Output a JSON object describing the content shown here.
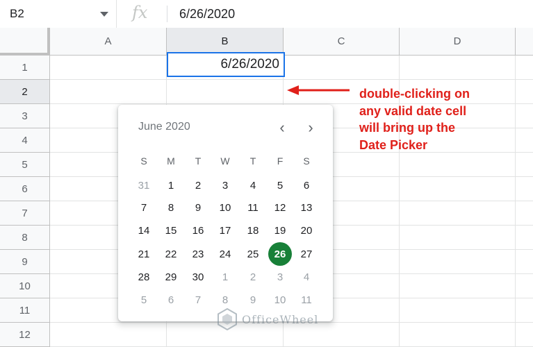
{
  "formula_bar": {
    "name_box": "B2",
    "fx_label": "fx",
    "value": "6/26/2020"
  },
  "columns": [
    "A",
    "B",
    "C",
    "D"
  ],
  "rows": [
    "1",
    "2",
    "3",
    "4",
    "5",
    "6",
    "7",
    "8",
    "9",
    "10",
    "11",
    "12"
  ],
  "selected_column": "B",
  "selected_row": "2",
  "active_cell": {
    "ref": "B2",
    "value": "6/26/2020"
  },
  "date_picker": {
    "month_label": "June 2020",
    "prev_icon": "chevron-left-icon",
    "next_icon": "chevron-right-icon",
    "weekdays": [
      "S",
      "M",
      "T",
      "W",
      "T",
      "F",
      "S"
    ],
    "weeks": [
      [
        "31",
        "1",
        "2",
        "3",
        "4",
        "5",
        "6"
      ],
      [
        "7",
        "8",
        "9",
        "10",
        "11",
        "12",
        "13"
      ],
      [
        "14",
        "15",
        "16",
        "17",
        "18",
        "19",
        "20"
      ],
      [
        "21",
        "22",
        "23",
        "24",
        "25",
        "26",
        "27"
      ],
      [
        "28",
        "29",
        "30",
        "1",
        "2",
        "3",
        "4"
      ],
      [
        "5",
        "6",
        "7",
        "8",
        "9",
        "10",
        "11"
      ]
    ],
    "selected_day": "26",
    "selected_color": "#188038"
  },
  "annotation": {
    "text": "double-clicking on\nany valid date cell\nwill bring up the\nDate Picker",
    "color": "#e0201a"
  },
  "watermark": {
    "text": "OfficeWheel"
  },
  "colors": {
    "selection_border": "#1a73e8",
    "header_bg": "#f8f9fa",
    "gridline": "#e2e3e3"
  }
}
